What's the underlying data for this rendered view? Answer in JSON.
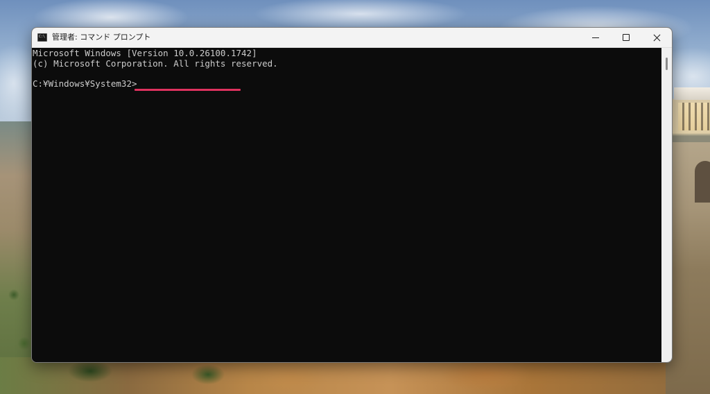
{
  "window": {
    "title": "管理者: コマンド プロンプト",
    "icon": "cmd-icon",
    "controls": {
      "minimize": "minimize-icon",
      "maximize": "maximize-icon",
      "close": "close-icon"
    }
  },
  "console": {
    "lines": [
      "Microsoft Windows [Version 10.0.26100.1742]",
      "(c) Microsoft Corporation. All rights reserved."
    ],
    "prompt": "C:¥Windows¥System32>",
    "input_value": ""
  },
  "colors": {
    "console_background": "#0c0c0c",
    "console_text": "#cccccc",
    "titlebar_background": "#f3f3f3",
    "highlight_underline": "#e0325f"
  }
}
